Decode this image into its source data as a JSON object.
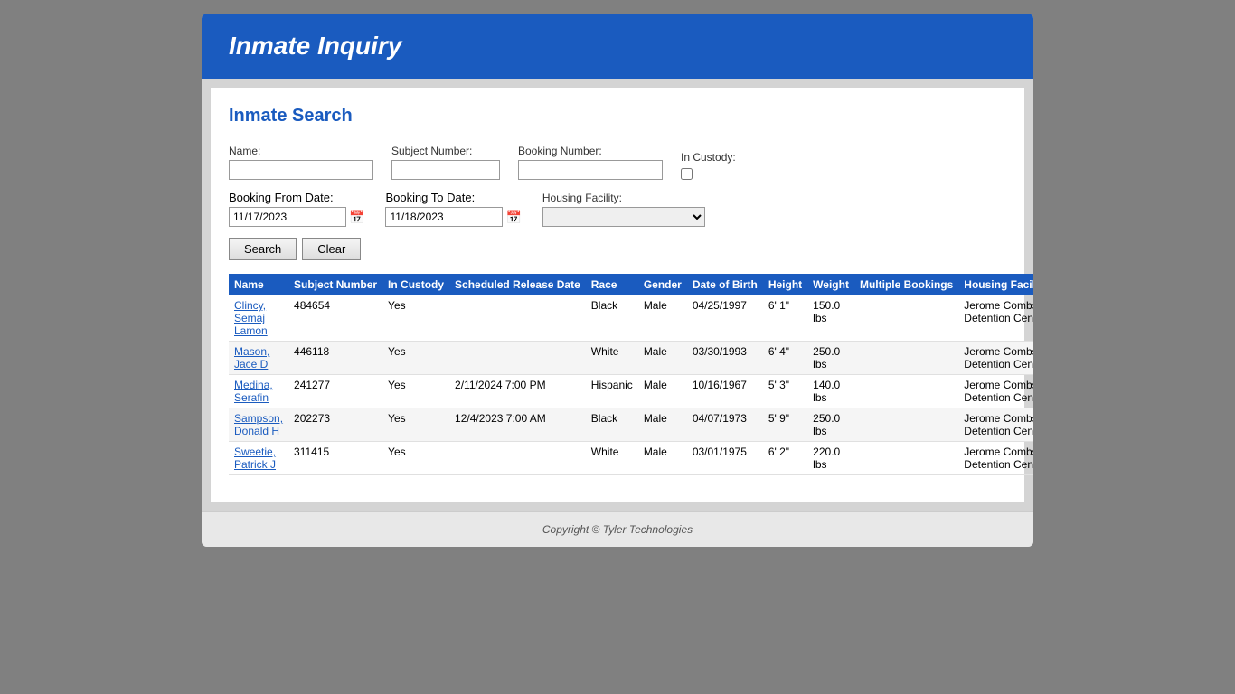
{
  "header": {
    "title": "Inmate Inquiry"
  },
  "page": {
    "title": "Inmate Search"
  },
  "form": {
    "name_label": "Name:",
    "subject_number_label": "Subject Number:",
    "booking_number_label": "Booking Number:",
    "in_custody_label": "In Custody:",
    "booking_from_label": "Booking From Date:",
    "booking_to_label": "Booking To Date:",
    "housing_facility_label": "Housing Facility:",
    "booking_from_value": "11/17/2023",
    "booking_to_value": "11/18/2023",
    "name_value": "",
    "subject_number_value": "",
    "booking_number_value": "",
    "search_btn": "Search",
    "clear_btn": "Clear",
    "housing_options": [
      {
        "value": "",
        "label": ""
      },
      {
        "value": "jerome",
        "label": "Jerome Combs Detention Center"
      }
    ]
  },
  "table": {
    "columns": [
      "Name",
      "Subject Number",
      "In Custody",
      "Scheduled Release Date",
      "Race",
      "Gender",
      "Date of Birth",
      "Height",
      "Weight",
      "Multiple Bookings",
      "Housing Facility"
    ],
    "rows": [
      {
        "name": "Clincy, Semaj Lamon",
        "subject_number": "484654",
        "in_custody": "Yes",
        "scheduled_release": "",
        "race": "Black",
        "gender": "Male",
        "dob": "04/25/1997",
        "height": "6' 1\"",
        "weight": "150.0 lbs",
        "multiple_bookings": "",
        "housing_facility": "Jerome Combs Detention Center"
      },
      {
        "name": "Mason, Jace D",
        "subject_number": "446118",
        "in_custody": "Yes",
        "scheduled_release": "",
        "race": "White",
        "gender": "Male",
        "dob": "03/30/1993",
        "height": "6' 4\"",
        "weight": "250.0 lbs",
        "multiple_bookings": "",
        "housing_facility": "Jerome Combs Detention Center"
      },
      {
        "name": "Medina, Serafin",
        "subject_number": "241277",
        "in_custody": "Yes",
        "scheduled_release": "2/11/2024 7:00 PM",
        "race": "Hispanic",
        "gender": "Male",
        "dob": "10/16/1967",
        "height": "5' 3\"",
        "weight": "140.0 lbs",
        "multiple_bookings": "",
        "housing_facility": "Jerome Combs Detention Center"
      },
      {
        "name": "Sampson, Donald H",
        "subject_number": "202273",
        "in_custody": "Yes",
        "scheduled_release": "12/4/2023 7:00 AM",
        "race": "Black",
        "gender": "Male",
        "dob": "04/07/1973",
        "height": "5' 9\"",
        "weight": "250.0 lbs",
        "multiple_bookings": "",
        "housing_facility": "Jerome Combs Detention Center"
      },
      {
        "name": "Sweetie, Patrick J",
        "subject_number": "311415",
        "in_custody": "Yes",
        "scheduled_release": "",
        "race": "White",
        "gender": "Male",
        "dob": "03/01/1975",
        "height": "6' 2\"",
        "weight": "220.0 lbs",
        "multiple_bookings": "",
        "housing_facility": "Jerome Combs Detention Center"
      }
    ]
  },
  "footer": {
    "copyright": "Copyright © Tyler Technologies"
  }
}
